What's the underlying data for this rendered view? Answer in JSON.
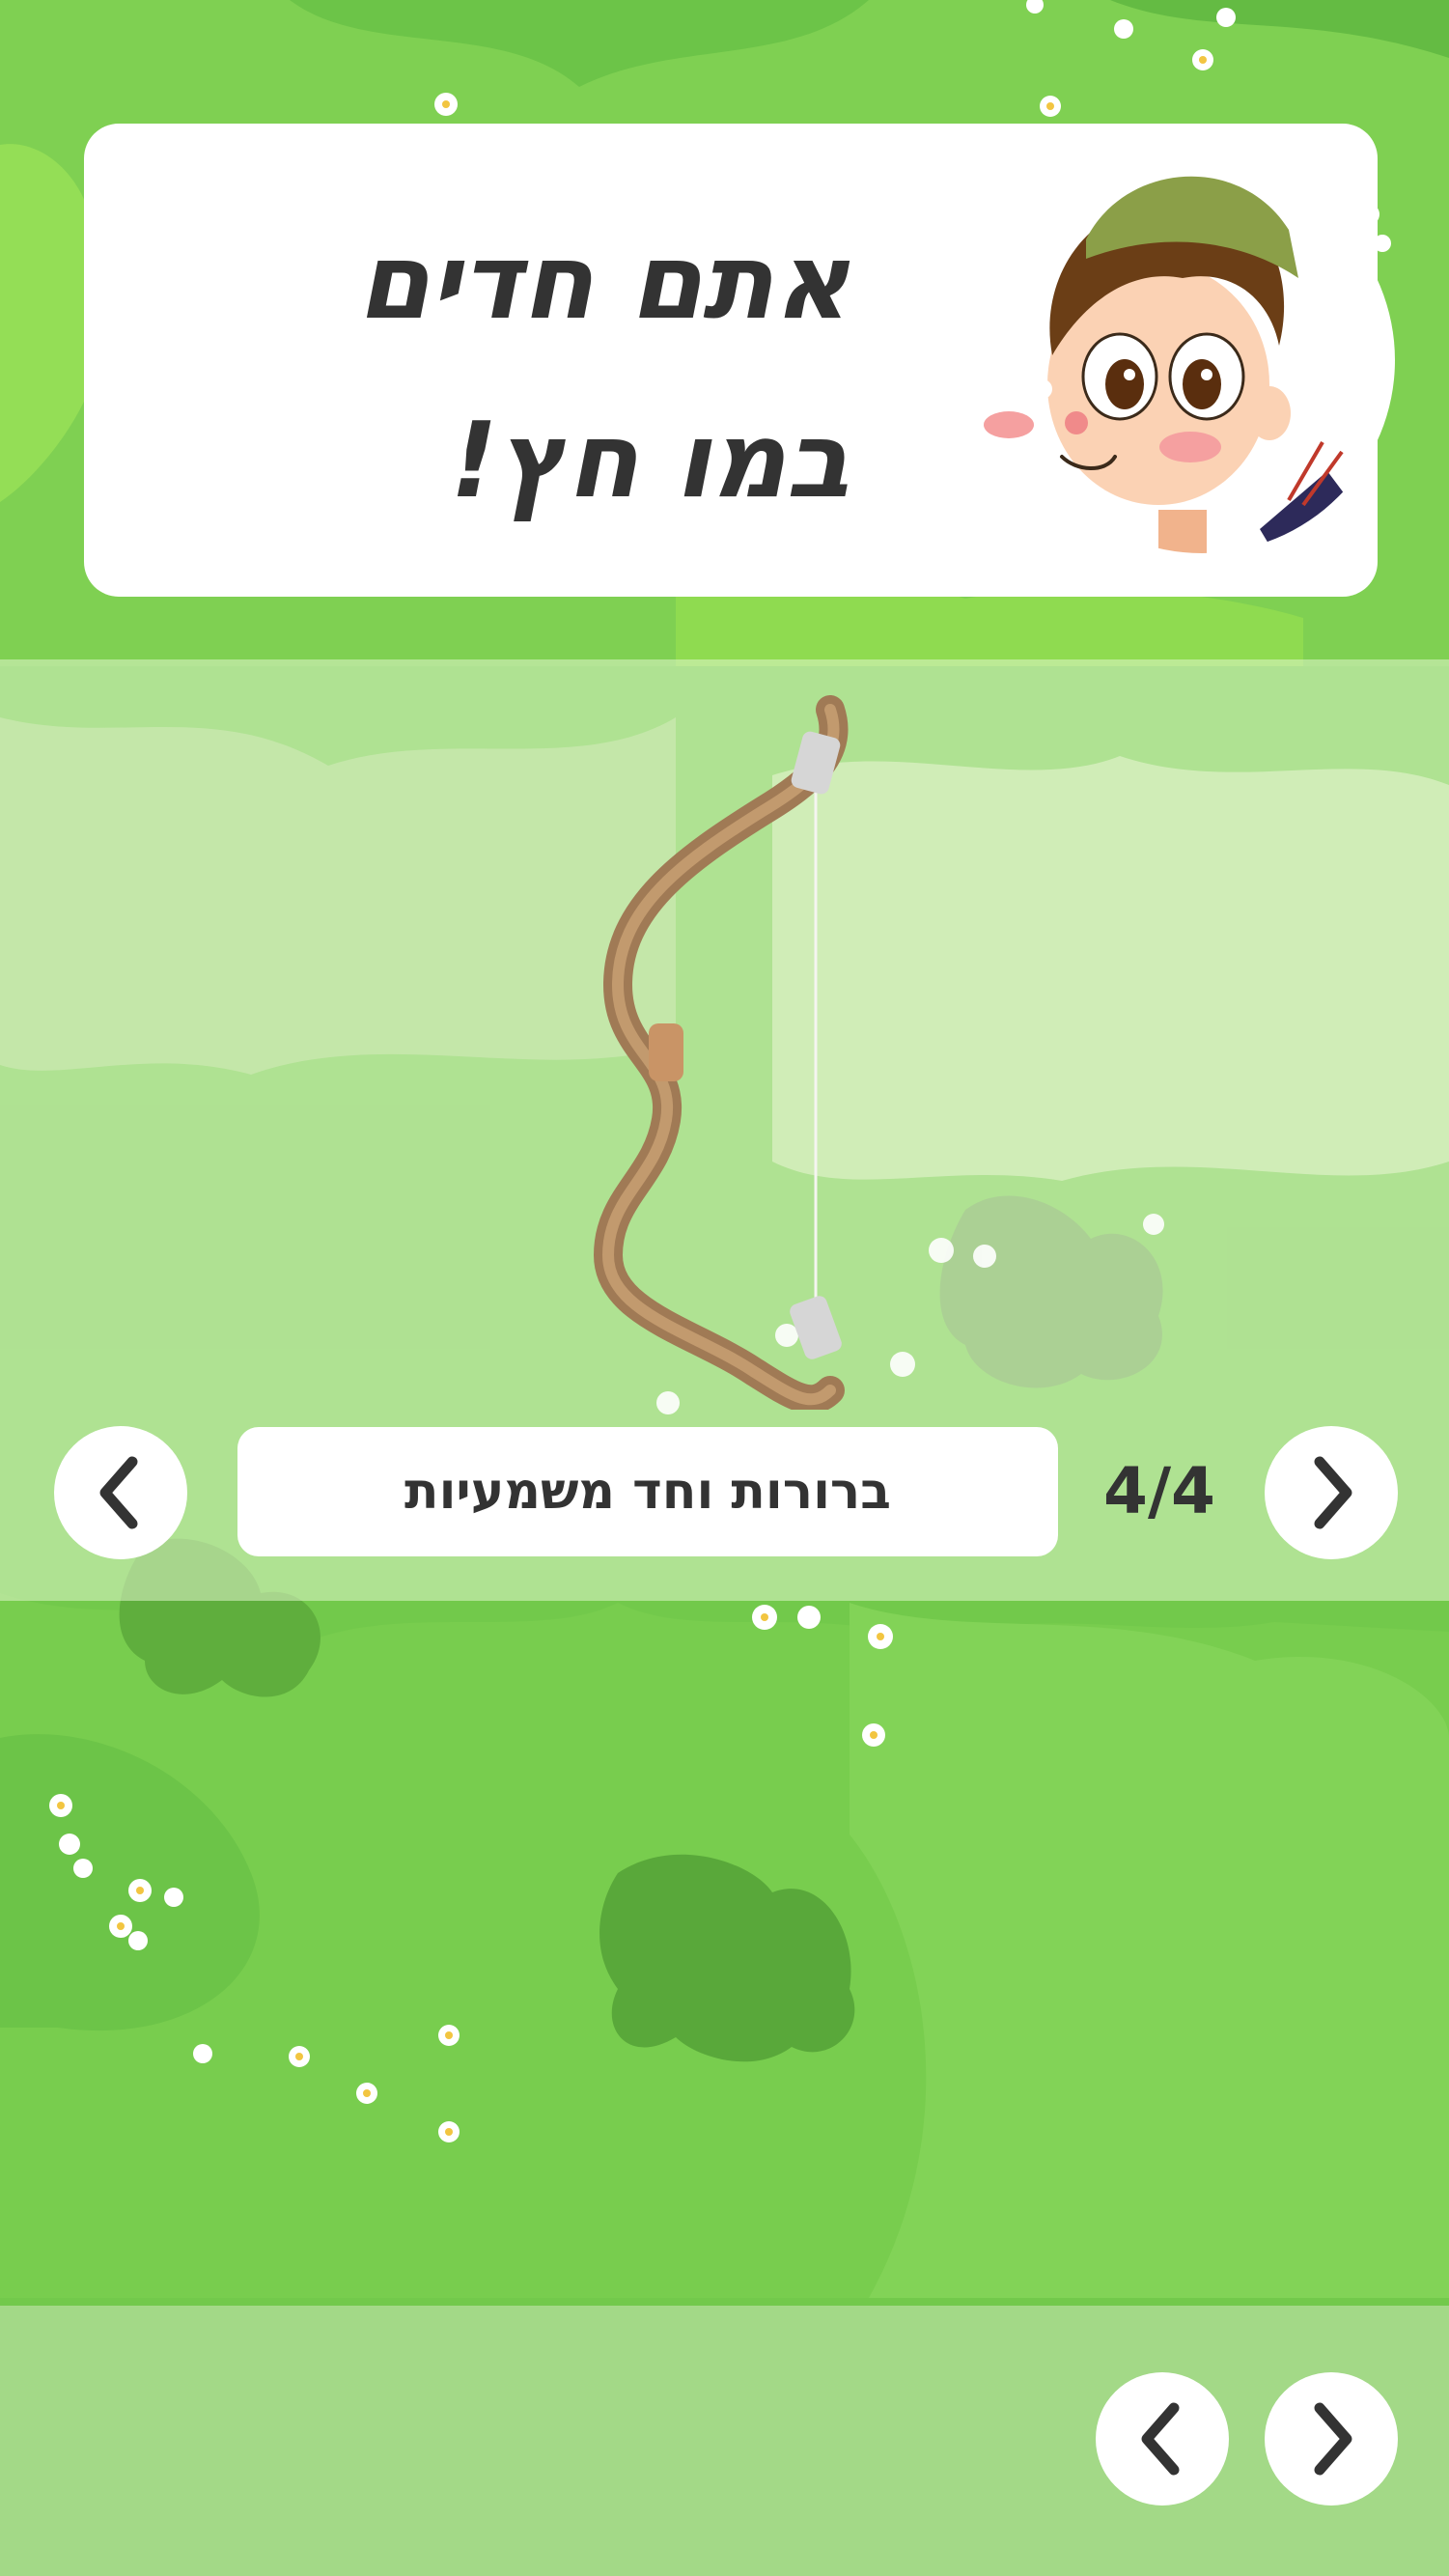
{
  "header": {
    "title_line1": "אתם חדים",
    "title_line2": "במו חץ!"
  },
  "slide": {
    "caption": "ברורות וחד משמעיות",
    "counter": "4/4"
  },
  "icons": {
    "prev": "chevron-left-icon",
    "next": "chevron-right-icon",
    "character": "archer-boy-illustration",
    "bow": "bow-illustration"
  },
  "colors": {
    "grass": "#6fc94a",
    "panel": "#d6efbf",
    "footer": "#a3d987",
    "text": "#333333"
  }
}
